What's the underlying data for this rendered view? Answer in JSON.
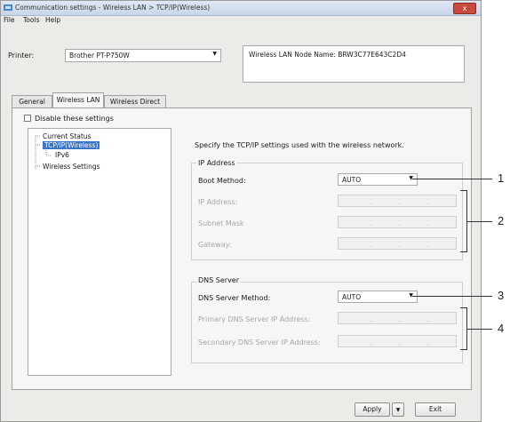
{
  "window": {
    "title": "Communication settings - Wireless LAN > TCP/IP(Wireless)",
    "close_label": "x"
  },
  "menu": {
    "file": "File",
    "tools": "Tools",
    "help": "Help"
  },
  "printer": {
    "label": "Printer:",
    "value": "Brother PT-P750W"
  },
  "node_name": "Wireless LAN Node Name: BRW3C77E643C2D4",
  "tabs": [
    "General",
    "Wireless LAN",
    "Wireless Direct"
  ],
  "disable_label": "Disable these settings",
  "tree": {
    "items": [
      "Current Status",
      "TCP/IP(Wireless)",
      "IPv6",
      "Wireless Settings"
    ]
  },
  "description": "Specify the TCP/IP settings used with the wireless network.",
  "ip_group": {
    "title": "IP Address",
    "boot_method_label": "Boot Method:",
    "boot_method_value": "AUTO",
    "ip_address_label": "IP Address:",
    "subnet_mask_label": "Subnet Mask",
    "gateway_label": "Gateway:"
  },
  "dns_group": {
    "title": "DNS Server",
    "method_label": "DNS Server Method:",
    "method_value": "AUTO",
    "primary_label": "Primary DNS Server IP Address:",
    "secondary_label": "Secondary DNS Server IP Address:"
  },
  "buttons": {
    "apply": "Apply",
    "exit": "Exit"
  },
  "callouts": [
    "1",
    "2",
    "3",
    "4"
  ]
}
